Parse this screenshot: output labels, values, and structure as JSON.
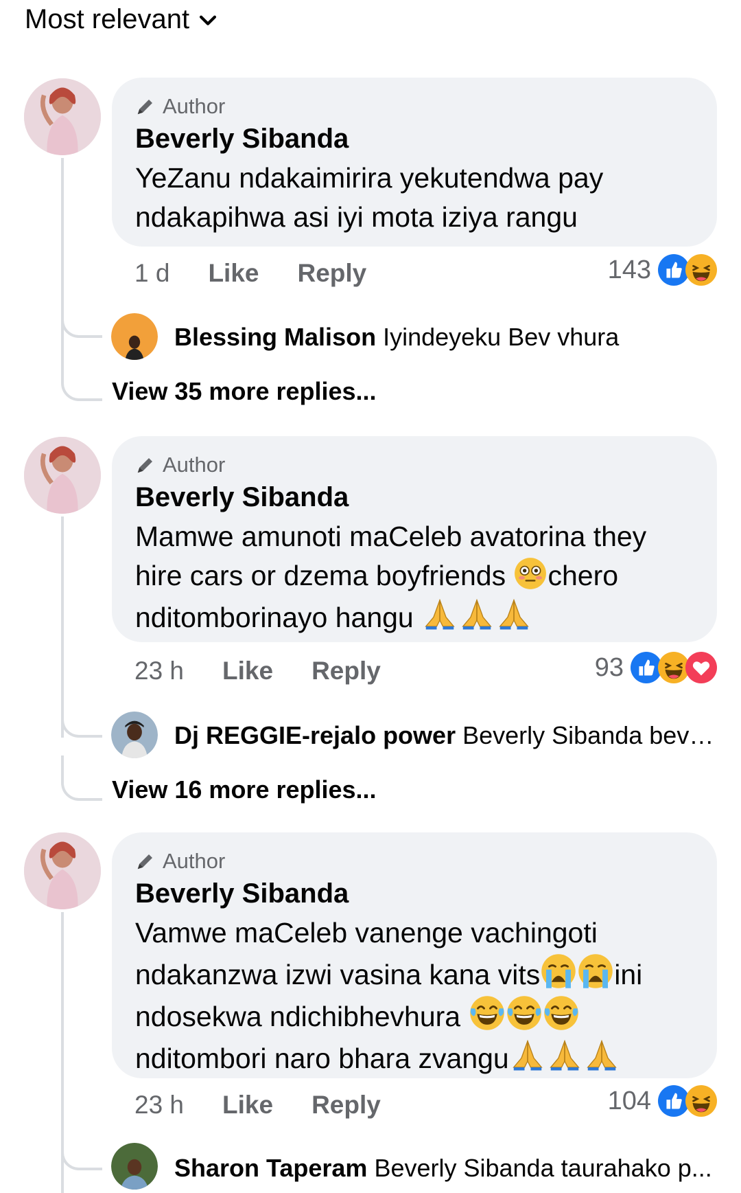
{
  "sort": {
    "label": "Most relevant"
  },
  "comments": [
    {
      "badge": "Author",
      "name": "Beverly Sibanda",
      "text": "YeZanu ndakaimirira yekutendwa pay ndakapihwa asi iyi mota iziya rangu",
      "time": "1 d",
      "like": "Like",
      "reply": "Reply",
      "reaction_count": "143",
      "reactions": [
        "like",
        "haha"
      ],
      "preview_reply": {
        "name": "Blessing Malison",
        "text": "Iyindeyeku Bev vhura"
      },
      "more_replies": "View 35 more replies..."
    },
    {
      "badge": "Author",
      "name": "Beverly Sibanda",
      "text_lines": [
        "Mamwe amunoti maCeleb avatorina they",
        "hire cars or dzema boyfriends ",
        "chero",
        "nditomborinayo hangu "
      ],
      "time": "23 h",
      "like": "Like",
      "reply": "Reply",
      "reaction_count": "93",
      "reactions": [
        "like",
        "haha",
        "love"
      ],
      "preview_reply": {
        "name": "Dj REGGIE-rejalo power",
        "text": "Beverly Sibanda bev ..."
      },
      "more_replies": "View 16 more replies..."
    },
    {
      "badge": "Author",
      "name": "Beverly Sibanda",
      "text_lines": [
        "Vamwe maCeleb vanenge vachingoti",
        "ndakanzwa izwi vasina kana vits",
        "ini",
        "ndosekwa ndichibhevhura ",
        "nditombori naro bhara zvangu"
      ],
      "time": "23 h",
      "like": "Like",
      "reply": "Reply",
      "reaction_count": "104",
      "reactions": [
        "like",
        "haha"
      ],
      "preview_reply": {
        "name": "Sharon Taperam",
        "text": "Beverly Sibanda taurahako p..."
      }
    }
  ],
  "colors": {
    "like_blue": "#1877f2",
    "haha_yellow": "#f7b125",
    "love_red": "#f33e58",
    "muted": "#65676b",
    "bubble": "#f0f2f5"
  }
}
